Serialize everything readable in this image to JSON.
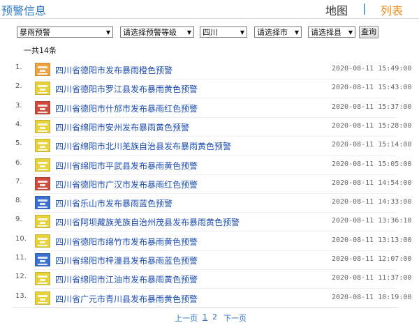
{
  "header": {
    "title": "预警信息",
    "tab_map": "地图",
    "separator": "|",
    "tab_list": "列表"
  },
  "filters": {
    "type": "暴雨预警",
    "level": "请选择预警等级",
    "province": "四川",
    "city": "请选择市",
    "county": "请选择县",
    "query_label": "查询"
  },
  "total": "一共14条",
  "colors": {
    "orange": "#f0a23c",
    "yellow": "#e8d23a",
    "red": "#d24a3c",
    "blue": "#3b6fd0"
  },
  "items": [
    {
      "num": "1.",
      "title": "四川省德阳市发布暴雨橙色预警",
      "time": "2020-08-11 15:49:00",
      "level": "orange",
      "icon": "rainstorm-orange-icon"
    },
    {
      "num": "2.",
      "title": "四川省德阳市罗江县发布暴雨黄色预警",
      "time": "2020-08-11 15:43:00",
      "level": "yellow",
      "icon": "rainstorm-yellow-icon"
    },
    {
      "num": "3.",
      "title": "四川省德阳市什邡市发布暴雨红色预警",
      "time": "2020-08-11 15:37:00",
      "level": "red",
      "icon": "rainstorm-red-icon"
    },
    {
      "num": "4.",
      "title": "四川省绵阳市安州发布暴雨黄色预警",
      "time": "2020-08-11 15:28:00",
      "level": "yellow",
      "icon": "rainstorm-yellow-icon"
    },
    {
      "num": "5.",
      "title": "四川省绵阳市北川羌族自治县发布暴雨黄色预警",
      "time": "2020-08-11 15:14:00",
      "level": "yellow",
      "icon": "rainstorm-yellow-icon"
    },
    {
      "num": "6.",
      "title": "四川省绵阳市平武县发布暴雨黄色预警",
      "time": "2020-08-11 15:05:00",
      "level": "yellow",
      "icon": "rainstorm-yellow-icon"
    },
    {
      "num": "7.",
      "title": "四川省德阳市广汉市发布暴雨红色预警",
      "time": "2020-08-11 14:54:00",
      "level": "red",
      "icon": "rainstorm-red-icon"
    },
    {
      "num": "8.",
      "title": "四川省乐山市发布暴雨蓝色预警",
      "time": "2020-08-11 14:33:00",
      "level": "blue",
      "icon": "rainstorm-blue-icon"
    },
    {
      "num": "9.",
      "title": "四川省阿坝藏族羌族自治州茂县发布暴雨黄色预警",
      "time": "2020-08-11 13:36:10",
      "level": "yellow",
      "icon": "rainstorm-yellow-icon"
    },
    {
      "num": "10.",
      "title": "四川省德阳市绵竹市发布暴雨黄色预警",
      "time": "2020-08-11 13:13:00",
      "level": "yellow",
      "icon": "rainstorm-yellow-icon"
    },
    {
      "num": "11.",
      "title": "四川省绵阳市梓潼县发布暴雨蓝色预警",
      "time": "2020-08-11 12:07:00",
      "level": "blue",
      "icon": "rainstorm-blue-icon"
    },
    {
      "num": "12.",
      "title": "四川省绵阳市江油市发布暴雨黄色预警",
      "time": "2020-08-11 11:37:00",
      "level": "yellow",
      "icon": "rainstorm-yellow-icon"
    },
    {
      "num": "13.",
      "title": "四川省广元市青川县发布暴雨黄色预警",
      "time": "2020-08-11 10:19:00",
      "level": "yellow",
      "icon": "rainstorm-yellow-icon"
    }
  ],
  "pager": {
    "prev": "上一页",
    "page1": "1",
    "page2": "2",
    "next": "下一页"
  }
}
